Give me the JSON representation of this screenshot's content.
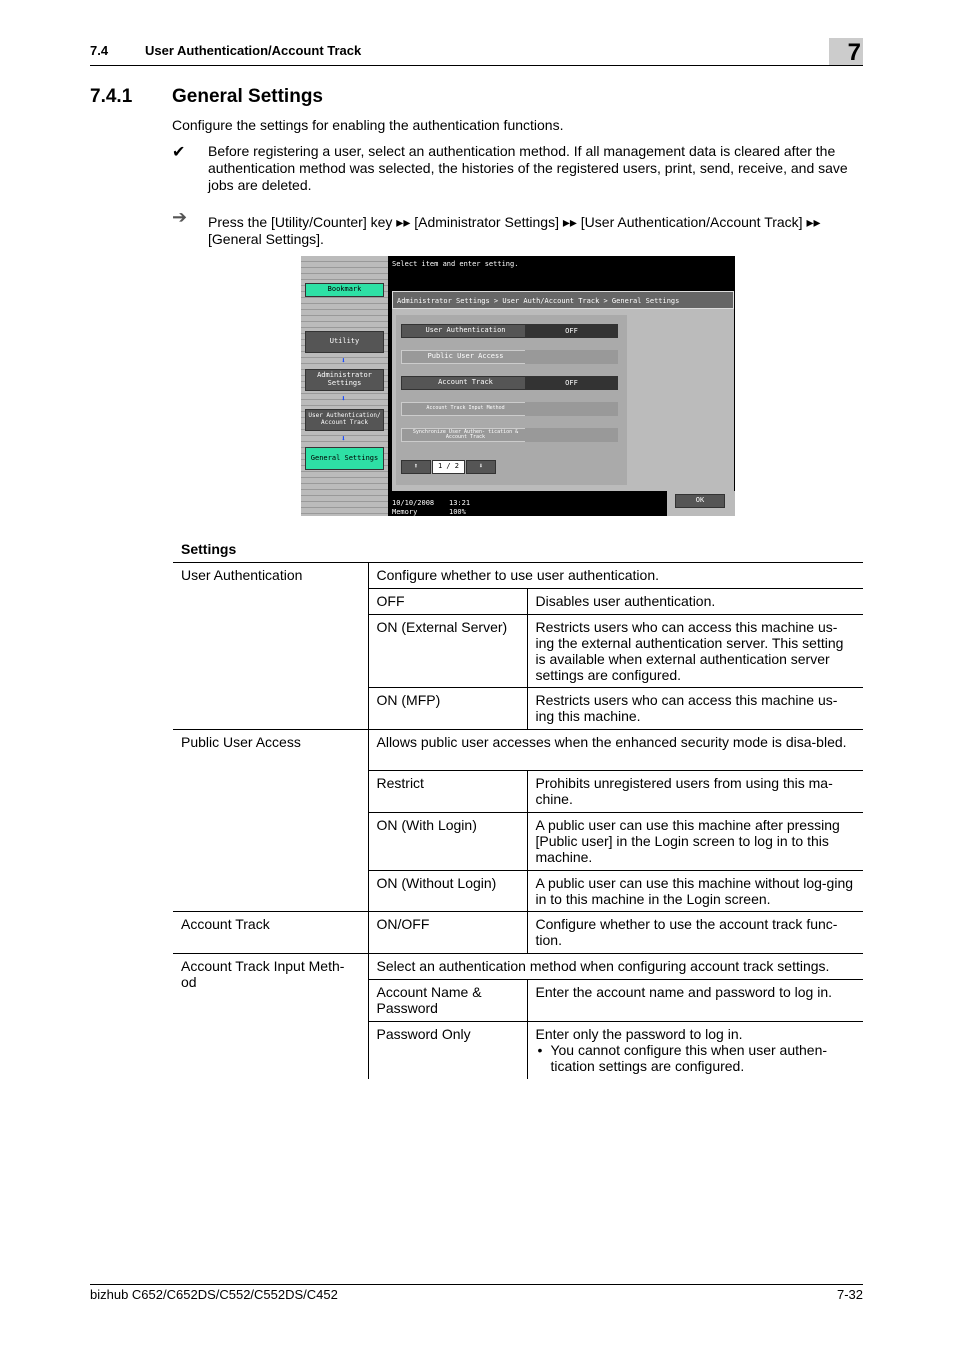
{
  "header": {
    "section_number": "7.4",
    "section_title": "User Authentication/Account Track",
    "chapter": "7"
  },
  "section": {
    "number": "7.4.1",
    "title": "General Settings"
  },
  "intro": "Configure the settings for enabling the authentication functions.",
  "note_icon": "checkmark-icon",
  "note": "Before registering a user, select an authentication method. If all management data is cleared after the authentication method was selected, the histories of the registered users, print, send, receive, and save jobs are deleted.",
  "step_icon": "arrow-right-icon",
  "step": "Press the [Utility/Counter] key ▸▸ [Administrator Settings] ▸▸ [User Authentication/Account Track] ▸▸ [General Settings].",
  "screen": {
    "message": "Select item and enter setting.",
    "bookmark": "Bookmark",
    "nav": [
      "Utility",
      "Administrator Settings",
      "User Authentication/ Account Track",
      "General Settings"
    ],
    "breadcrumb": "Administrator Settings > User Auth/Account Track  > General Settings",
    "items": [
      {
        "label": "User Authentication",
        "value": "OFF"
      },
      {
        "label": "Public User Access",
        "value": ""
      },
      {
        "label": "Account Track",
        "value": "OFF"
      },
      {
        "label": "Account Track Input Method",
        "value": ""
      },
      {
        "label": "Synchronize User Authen- tication & Account Track",
        "value": ""
      }
    ],
    "page": "1 / 2",
    "date": "10/10/2008",
    "time": "13:21",
    "memory_label": "Memory",
    "memory": "100%",
    "ok": "OK"
  },
  "settings_title": "Settings",
  "table": {
    "user_auth": {
      "name": "User Authentication",
      "desc": "Configure whether to use user authentication.",
      "opts": [
        [
          "OFF",
          "Disables user authentication."
        ],
        [
          "ON (External Server)",
          "Restricts users who can access this machine us-ing the external authentication server. This setting is available when external authentication server settings are configured."
        ],
        [
          "ON (MFP)",
          "Restricts users who can access this machine us-ing this machine."
        ]
      ]
    },
    "public": {
      "name": "Public User Access",
      "desc": "Allows public user accesses when the enhanced security mode is disa-bled.",
      "opts": [
        [
          "Restrict",
          "Prohibits unregistered users from using this ma-chine."
        ],
        [
          "ON (With Login)",
          "A public user can use this machine after pressing [Public user] in the Login screen to log in to this machine."
        ],
        [
          "ON (Without Login)",
          "A public user can use this machine without log-ging in to this machine in the Login screen."
        ]
      ]
    },
    "acct": {
      "name": "Account Track",
      "opt": "ON/OFF",
      "desc": "Configure whether to use the account track func-tion."
    },
    "input": {
      "name": "Account Track Input Meth-od",
      "desc": "Select an authentication method when configuring account track settings.",
      "opts": [
        [
          "Account Name & Password",
          "Enter the account name and password to log in."
        ],
        [
          "Password Only",
          "Enter only the password to log in."
        ]
      ],
      "bullet": "You cannot configure this when user authen-tication settings are configured."
    }
  },
  "footer": {
    "model": "bizhub C652/C652DS/C552/C552DS/C452",
    "page": "7-32"
  }
}
